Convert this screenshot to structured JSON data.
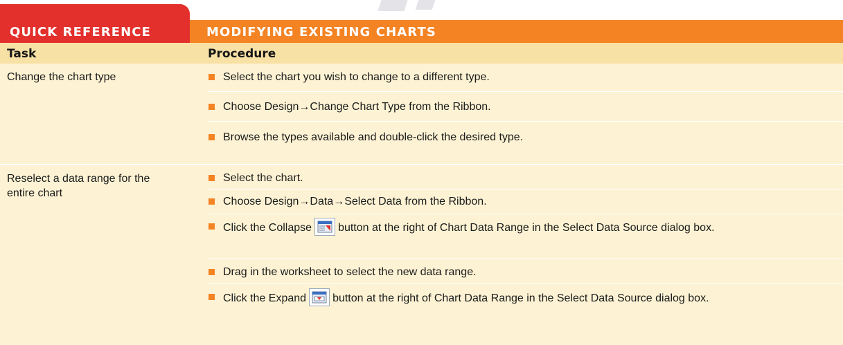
{
  "header": {
    "quick_reference": "QUICK REFERENCE",
    "title": "MODIFYING EXISTING CHARTS"
  },
  "table": {
    "columns": {
      "task": "Task",
      "procedure": "Procedure"
    },
    "rows": [
      {
        "task": "Change the chart type",
        "steps": [
          "Select the chart you wish to change to a different type.",
          "Choose Design→Change Chart Type from the Ribbon.",
          "Browse the types available and double-click the desired type."
        ]
      },
      {
        "task": "Reselect a data range for the entire chart",
        "steps": [
          "Select the chart.",
          "Choose Design→Data→Select Data from the Ribbon.",
          {
            "before": "Click the Collapse",
            "icon": "collapse-dialog-icon",
            "after": "button at the right of Chart Data Range in the Select Data Source dialog box."
          },
          "Drag in the worksheet to select the new data range.",
          {
            "before": "Click the Expand",
            "icon": "expand-dialog-icon",
            "after": "button at the right of Chart Data Range in the Select Data Source dialog box."
          }
        ]
      }
    ]
  },
  "colors": {
    "tab_red": "#e3302c",
    "tab_orange": "#f48324",
    "header_row": "#f8e1a5",
    "body": "#fdf3d4",
    "bullet": "#f48324"
  }
}
